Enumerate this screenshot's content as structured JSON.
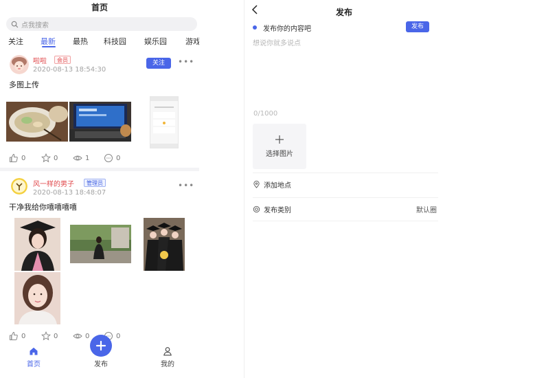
{
  "home": {
    "title": "首页",
    "search_placeholder": "点我搜索",
    "tabs": [
      "关注",
      "最新",
      "最热",
      "科技园",
      "娱乐园",
      "游戏"
    ],
    "active_tab": "最新",
    "posts": [
      {
        "username": "啦啦",
        "role": "会员",
        "time": "2020-08-13 18:54:30",
        "follow_label": "关注",
        "text": "多图上传",
        "likes": "0",
        "favorites": "0",
        "views": "1",
        "comments": "0"
      },
      {
        "username": "风一样的男子",
        "role": "管理员",
        "time": "2020-08-13 18:48:07",
        "text": "干净我给你嘻嘻嘻嘻",
        "likes": "0",
        "favorites": "0",
        "views": "0",
        "comments": "0"
      }
    ],
    "nav": {
      "home": "首页",
      "publish": "发布",
      "mine": "我的"
    }
  },
  "publish": {
    "title": "发布",
    "hint": "发布你的内容吧",
    "button": "发布",
    "textarea_placeholder": "想说你就多说点",
    "counter": "0/1000",
    "choose_image": "选择图片",
    "add_location": "添加地点",
    "category_label": "发布类别",
    "category_value": "默认圈"
  },
  "colors": {
    "accent": "#4a66e8",
    "username": "#e0484b"
  }
}
